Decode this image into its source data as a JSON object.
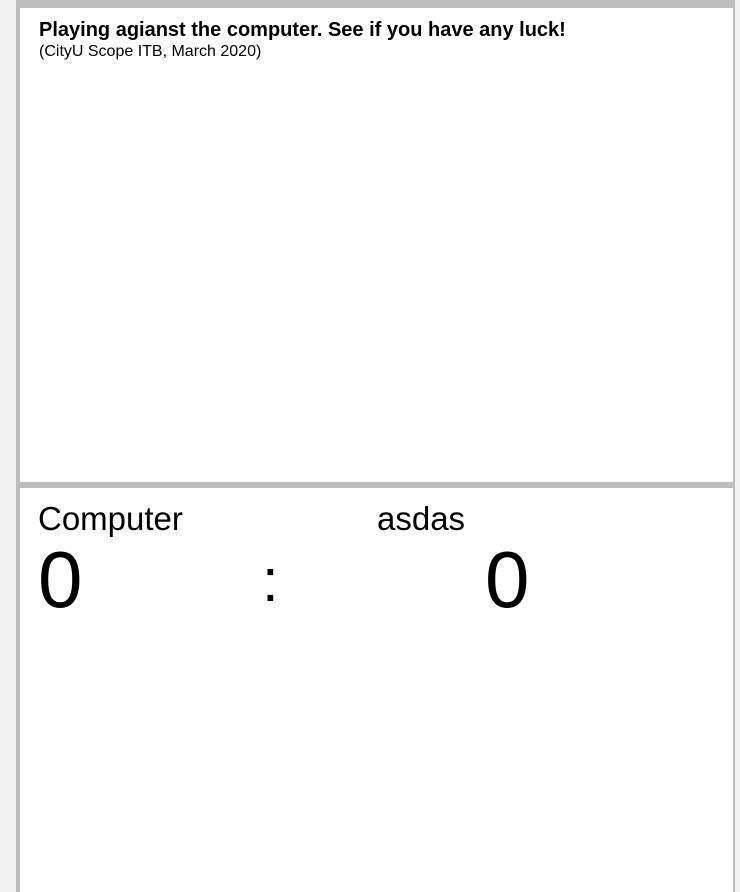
{
  "header": {
    "title": "Playing agianst the computer. See if you have any luck!",
    "subtitle": "(CityU Scope ITB, March 2020)"
  },
  "scoreboard": {
    "player1_name": "Computer",
    "player2_name": "asdas",
    "player1_score": "0",
    "separator": ":",
    "player2_score": "0"
  }
}
